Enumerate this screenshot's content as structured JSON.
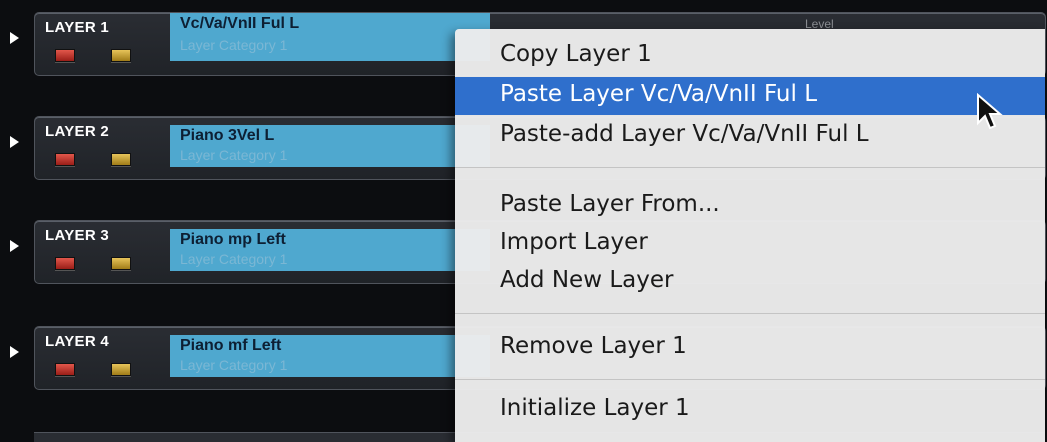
{
  "layers": [
    {
      "label": "LAYER 1",
      "preset": "Vc/Va/VnII Ful L",
      "category": "Layer Category 1"
    },
    {
      "label": "LAYER 2",
      "preset": "Piano 3Vel L",
      "category": "Layer Category 1"
    },
    {
      "label": "LAYER 3",
      "preset": "Piano mp Left",
      "category": "Layer Category 1"
    },
    {
      "label": "LAYER 4",
      "preset": "Piano mf Left",
      "category": "Layer Category 1"
    }
  ],
  "level_label": "Level",
  "context_menu": {
    "items": [
      {
        "label": "Copy Layer 1",
        "selected": false
      },
      {
        "label": "Paste Layer Vc/Va/VnII Ful L",
        "selected": true
      },
      {
        "label": "Paste-add Layer Vc/Va/VnII Ful L",
        "selected": false
      },
      {
        "label": "Paste Layer From...",
        "selected": false
      },
      {
        "label": "Import Layer",
        "selected": false
      },
      {
        "label": "Add New Layer",
        "selected": false
      },
      {
        "label": "Remove Layer 1",
        "selected": false
      },
      {
        "label": "Initialize Layer 1",
        "selected": false
      }
    ]
  },
  "colors": {
    "accent_selected": "#2f6fcc",
    "name_box": "#4fa8cf",
    "mute_button": "#c9362d",
    "solo_button": "#c9a23a"
  },
  "icons": [
    "expand-arrow-icon",
    "mouse-pointer-icon"
  ]
}
